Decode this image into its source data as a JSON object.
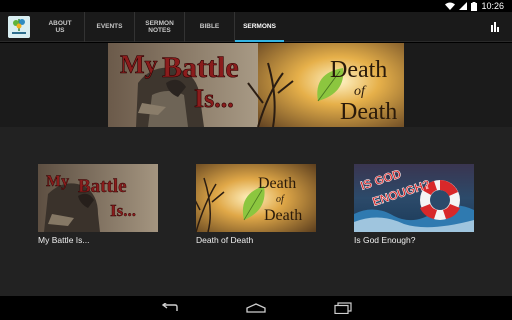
{
  "status_bar": {
    "time": "10:26"
  },
  "app": {
    "logo_icon": "church-logo-icon",
    "accent_color": "#33b5e5"
  },
  "tabs": [
    {
      "label_line1": "ABOUT",
      "label_line2": "US",
      "active": false
    },
    {
      "label_line1": "EVENTS",
      "label_line2": "",
      "active": false
    },
    {
      "label_line1": "SERMON",
      "label_line2": "NOTES",
      "active": false
    },
    {
      "label_line1": "BIBLE",
      "label_line2": "",
      "active": false
    },
    {
      "label_line1": "SERMONS",
      "label_line2": "",
      "active": true
    }
  ],
  "hero": {
    "left_text_1": "My",
    "left_text_2": "Battle",
    "left_text_3": "Is...",
    "right_text_1": "Death",
    "right_text_2": "of",
    "right_text_3": "Death"
  },
  "sermons": [
    {
      "title": "My Battle Is...",
      "art_1": "My",
      "art_2": "Battle",
      "art_3": "Is..."
    },
    {
      "title": "Death of Death",
      "art_1": "Death",
      "art_2": "of",
      "art_3": "Death"
    },
    {
      "title": "Is God Enough?",
      "art_1": "IS GOD",
      "art_2": "ENOUGH?"
    }
  ],
  "nav": {
    "back_icon": "back-icon",
    "home_icon": "home-icon",
    "recent_icon": "recent-apps-icon"
  }
}
